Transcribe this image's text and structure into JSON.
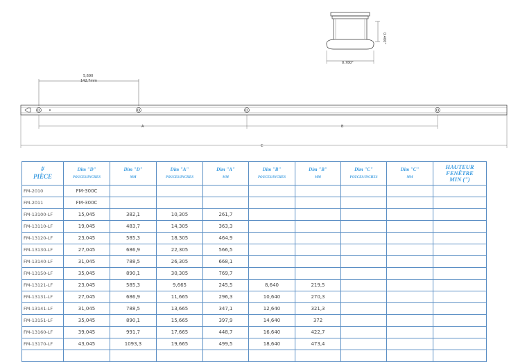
{
  "drawing": {
    "section": {
      "height_label": "0.400\"",
      "width_label": "0.780\""
    },
    "offset": {
      "inches": "5,690",
      "mm": "142,7mm"
    },
    "dim_a": "A",
    "dim_b": "B",
    "dim_c": "C"
  },
  "table": {
    "headers": {
      "piece_line1": "#",
      "piece_line2": "PIÈCE",
      "d_in_1": "Dim \"D\"",
      "d_in_2": "POUCES/INCHES",
      "d_mm_1": "Dim \"D\"",
      "d_mm_2": "MM",
      "a_in_1": "Dim \"A\"",
      "a_in_2": "POUCES/INCHES",
      "a_mm_1": "Dim \"A\"",
      "a_mm_2": "MM",
      "b_in_1": "Dim \"B\"",
      "b_in_2": "POUCES/INCHES",
      "b_mm_1": "Dim \"B\"",
      "b_mm_2": "MM",
      "c_in_1": "Dim \"C\"",
      "c_in_2": "POUCES/INCHES",
      "c_mm_1": "Dim \"C\"",
      "c_mm_2": "MM",
      "hauteur_1": "HAUTEUR",
      "hauteur_2": "FENÊTRE",
      "hauteur_3": "MIN  (\")"
    },
    "rows": [
      [
        "FM-2010",
        "FM-300C",
        "",
        "",
        "",
        "",
        "",
        "",
        "",
        ""
      ],
      [
        "FM-2011",
        "FM-300C",
        "",
        "",
        "",
        "",
        "",
        "",
        "",
        ""
      ],
      [
        "FM-13100-LF",
        "15,045",
        "382,1",
        "10,305",
        "261,7",
        "",
        "",
        "",
        "",
        ""
      ],
      [
        "FM-13110-LF",
        "19,045",
        "483,7",
        "14,305",
        "363,3",
        "",
        "",
        "",
        "",
        ""
      ],
      [
        "FM-13120-LF",
        "23,045",
        "585,3",
        "18,305",
        "464,9",
        "",
        "",
        "",
        "",
        ""
      ],
      [
        "FM-13130-LF",
        "27,045",
        "686,9",
        "22,305",
        "566,5",
        "",
        "",
        "",
        "",
        ""
      ],
      [
        "FM-13140-LF",
        "31,045",
        "788,5",
        "26,305",
        "668,1",
        "",
        "",
        "",
        "",
        ""
      ],
      [
        "FM-13150-LF",
        "35,045",
        "890,1",
        "30,305",
        "769,7",
        "",
        "",
        "",
        "",
        ""
      ],
      [
        "FM-13121-LF",
        "23,045",
        "585,3",
        "9,665",
        "245,5",
        "8,640",
        "219,5",
        "",
        "",
        ""
      ],
      [
        "FM-13131-LF",
        "27,045",
        "686,9",
        "11,665",
        "296,3",
        "10,640",
        "270,3",
        "",
        "",
        ""
      ],
      [
        "FM-13141-LF",
        "31,045",
        "788,5",
        "13,665",
        "347,1",
        "12,640",
        "321,3",
        "",
        "",
        ""
      ],
      [
        "FM-13151-LF",
        "35,045",
        "890,1",
        "15,665",
        "397,9",
        "14,640",
        "372",
        "",
        "",
        ""
      ],
      [
        "FM-13160-LF",
        "39,045",
        "991,7",
        "17,665",
        "448,7",
        "16,640",
        "422,7",
        "",
        "",
        ""
      ],
      [
        "FM-13170-LF",
        "43,045",
        "1093,3",
        "19,665",
        "499,5",
        "18,640",
        "473,4",
        "",
        "",
        ""
      ],
      [
        "",
        "",
        "",
        "",
        "",
        "",
        "",
        "",
        "",
        ""
      ]
    ]
  }
}
